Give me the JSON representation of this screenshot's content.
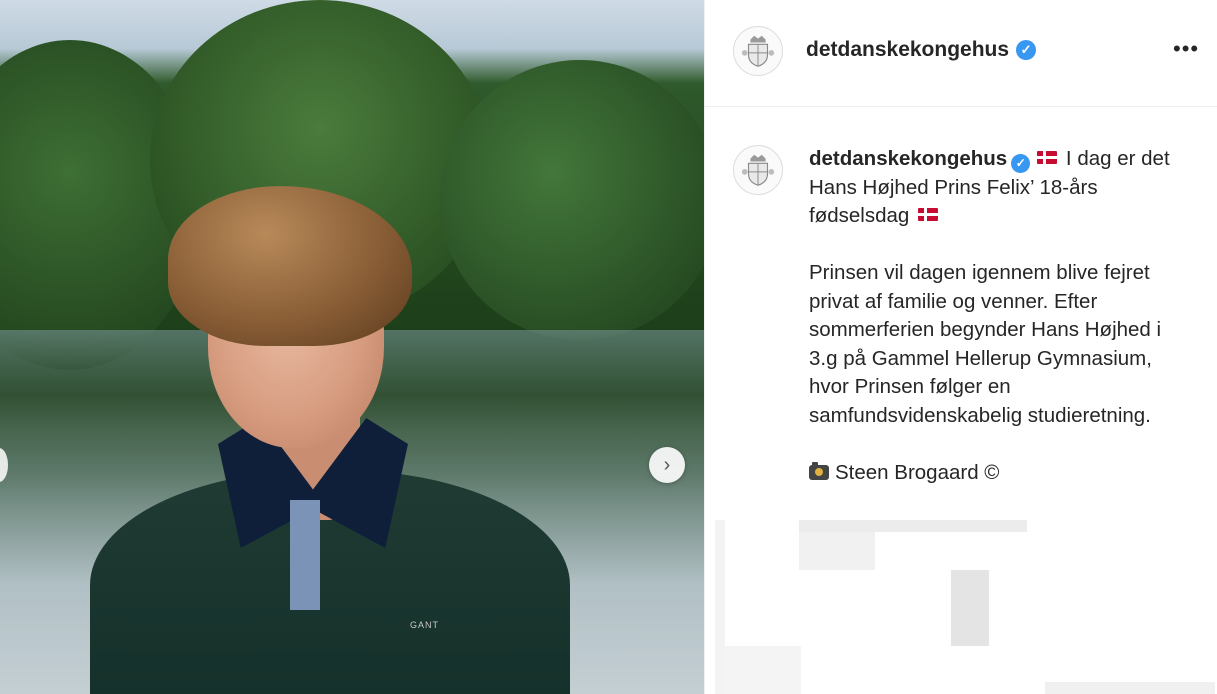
{
  "post": {
    "username": "detdanskekongehus",
    "verified": true,
    "more_label": "•••",
    "caption": {
      "line1": "I dag er det Hans Højhed Prins Felix’ 18-års fødselsdag",
      "paragraph2": "Prinsen vil dagen igennem blive fejret privat af familie og venner. Efter sommerferien begynder Hans Højhed i 3.g på Gammel Hellerup Gymnasium, hvor Prinsen følger en samfundsvidenskabelig studieretning.",
      "credit": "Steen Brogaard ©"
    },
    "photo": {
      "shirt_logo": "GANT",
      "next_label": "›"
    }
  },
  "colors": {
    "verified_badge": "#3897f0",
    "text": "#262626",
    "border": "#efefef",
    "flag_red": "#c60c30"
  },
  "icons": {
    "verified": "verified-badge-icon",
    "flag": "denmark-flag-icon",
    "camera": "camera-flash-icon",
    "more": "more-options-icon",
    "next": "chevron-right-icon"
  }
}
